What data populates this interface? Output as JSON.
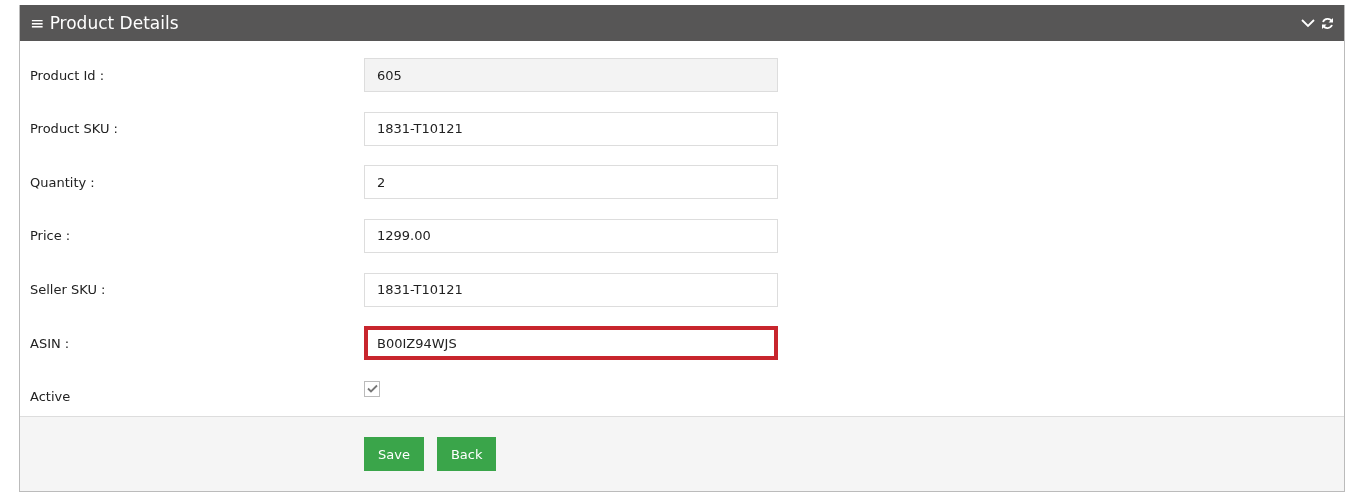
{
  "panel": {
    "title": "Product Details",
    "menu_icon": "≡"
  },
  "fields": [
    {
      "kind": "text",
      "label": "Product Id :",
      "value": "605",
      "readonly": true,
      "highlighted": false
    },
    {
      "kind": "text",
      "label": "Product SKU :",
      "value": "1831-T10121",
      "readonly": false,
      "highlighted": false
    },
    {
      "kind": "text",
      "label": "Quantity :",
      "value": "2",
      "readonly": false,
      "highlighted": false
    },
    {
      "kind": "text",
      "label": "Price :",
      "value": "1299.00",
      "readonly": false,
      "highlighted": false
    },
    {
      "kind": "text",
      "label": "Seller SKU :",
      "value": "1831-T10121",
      "readonly": false,
      "highlighted": false
    },
    {
      "kind": "text",
      "label": "ASIN :",
      "value": "B00IZ94WJS",
      "readonly": false,
      "highlighted": true
    },
    {
      "kind": "checkbox",
      "label": "Active",
      "checked": true
    }
  ],
  "buttons": [
    "Save",
    "Back"
  ]
}
